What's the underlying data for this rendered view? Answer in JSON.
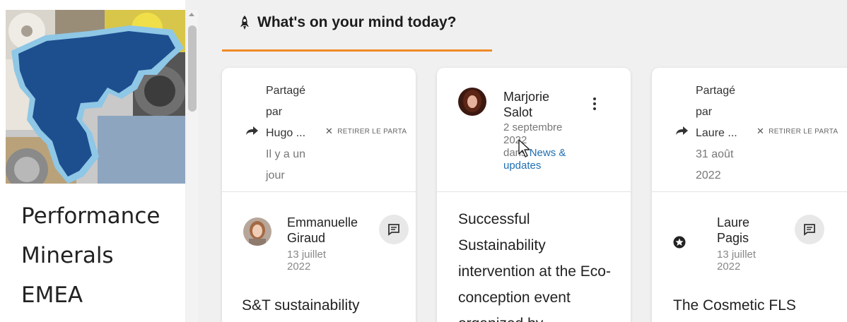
{
  "site": {
    "title": "Performance\nMinerals\nEMEA"
  },
  "header": {
    "title": "What's on your mind today?"
  },
  "cards": [
    {
      "share_lines": [
        "Partagé",
        "par",
        "Hugo ..."
      ],
      "share_time": "Il y a un jour",
      "remove_label": "RETIRER LE PARTA",
      "author_name": "Emmanuelle Giraud",
      "author_date": "13 juillet 2022",
      "post_title": "S&T sustainability"
    },
    {
      "author_name": "Marjorie Salot",
      "date": "2 septembre 2022",
      "in_label": "dans",
      "category": "News & updates",
      "post_title": "Successful Sustainability intervention at the Eco-conception event organized by"
    },
    {
      "share_lines": [
        "Partagé",
        "par",
        "Laure ..."
      ],
      "share_time": "31 août 2022",
      "remove_label": "RETIRER LE PARTA",
      "author_name": "Laure Pagis",
      "author_date": "13 juillet 2022",
      "post_title": "The Cosmetic FLS"
    }
  ],
  "colors": {
    "accent": "#f08a24",
    "link": "#1f6fb2"
  },
  "icons": {
    "header": "rocket-icon",
    "share": "share-arrow-icon",
    "remove": "close-icon",
    "comment": "comment-icon",
    "menu": "more-vertical-icon",
    "badge": "star-badge-icon"
  }
}
